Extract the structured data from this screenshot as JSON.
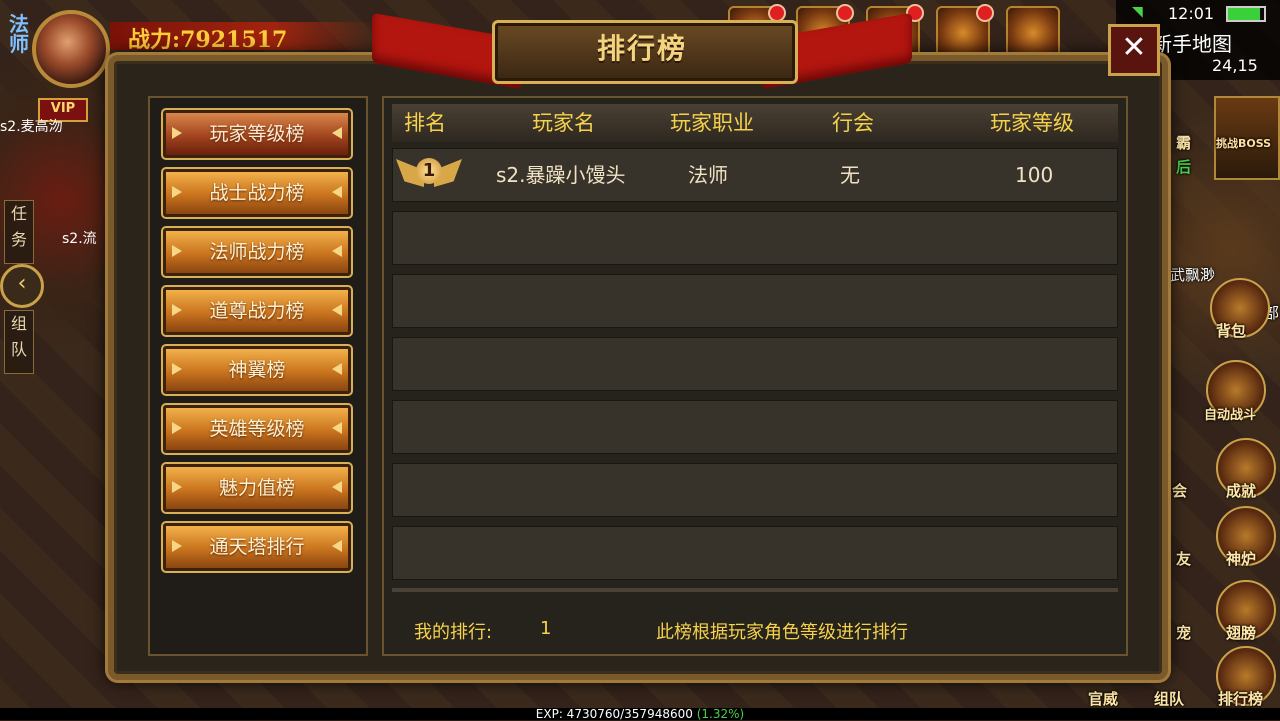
{
  "hud": {
    "class_glyph": "法师",
    "vip": "VIP",
    "power_text": "战力:7921517",
    "player_tag": "s2.麦高沕",
    "player_tag_near": "s2.流",
    "tab_task": "任务",
    "tab_team": "组队",
    "clock": "12:01",
    "map_name": "新手地图",
    "map_coord": "24,15",
    "boss_label": "挑战BOSS",
    "other_player": "武飘渺",
    "exp": "EXP: 4730760/357948600",
    "exp_pct": "(1.32%)"
  },
  "right_menu": {
    "bag": "背包",
    "auto_battle": "自动战斗",
    "achievement": "成就",
    "furnace": "神炉",
    "wings": "翅膀",
    "ranking": "排行榜",
    "guild_short": "会",
    "friend_short": "友",
    "pet_short": "宠",
    "team": "组队",
    "official": "官威",
    "ba": "霸",
    "hou": "后",
    "bu": "部"
  },
  "panel": {
    "title": "排行榜",
    "close": "✕",
    "categories": [
      {
        "label": "玩家等级榜",
        "active": true
      },
      {
        "label": "战士战力榜",
        "active": false
      },
      {
        "label": "法师战力榜",
        "active": false
      },
      {
        "label": "道尊战力榜",
        "active": false
      },
      {
        "label": "神翼榜",
        "active": false
      },
      {
        "label": "英雄等级榜",
        "active": false
      },
      {
        "label": "魅力值榜",
        "active": false
      },
      {
        "label": "通天塔排行",
        "active": false
      }
    ],
    "columns": [
      "排名",
      "玩家名",
      "玩家职业",
      "行会",
      "玩家等级"
    ],
    "rows": [
      {
        "rank": "1",
        "name": "s2.暴躁小馒头",
        "class": "法师",
        "guild": "无",
        "level": "100"
      }
    ],
    "my_rank_label": "我的排行:",
    "my_rank_value": "1",
    "note": "此榜根据玩家角色等级进行排行"
  },
  "colors": {
    "accent": "#f6d24a",
    "ribbon": "#b3160f"
  }
}
